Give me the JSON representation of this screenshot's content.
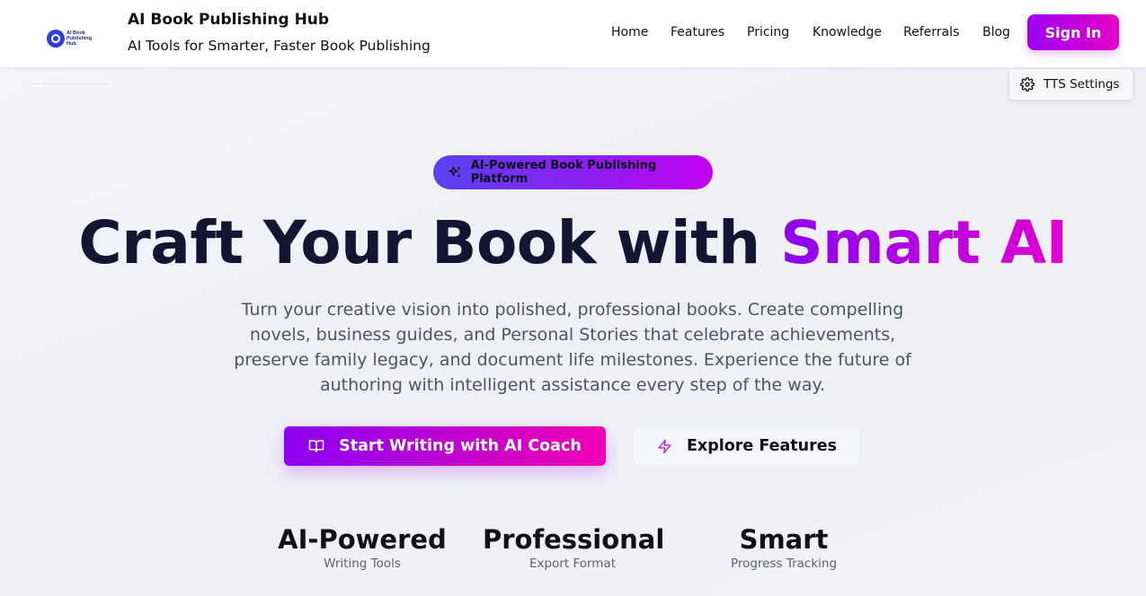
{
  "header": {
    "logo_text": "AI Book Publishing Hub",
    "title": "AI Book Publishing Hub",
    "subtitle": "AI Tools for Smarter, Faster Book Publishing",
    "nav": [
      {
        "label": "Home"
      },
      {
        "label": "Features"
      },
      {
        "label": "Pricing"
      },
      {
        "label": "Knowledge"
      },
      {
        "label": "Referrals"
      },
      {
        "label": "Blog"
      }
    ],
    "signin_label": "Sign In"
  },
  "tts": {
    "label": "TTS Settings",
    "icon": "gear-icon"
  },
  "hero": {
    "badge": {
      "label": "AI-Powered Book Publishing Platform",
      "icon": "sparkles-icon"
    },
    "headline_main": "Craft Your Book with ",
    "headline_accent": "Smart AI",
    "lead": "Turn your creative vision into polished, professional books. Create compelling novels, business guides, and Personal Stories that celebrate achievements, preserve family legacy, and document life milestones. Experience the future of authoring with intelligent assistance every step of the way.",
    "cta_primary": {
      "label": "Start Writing with AI Coach",
      "icon": "book-open-icon"
    },
    "cta_secondary": {
      "label": "Explore Features",
      "icon": "lightning-icon"
    }
  },
  "stats": [
    {
      "title": "AI-Powered",
      "sub": "Writing Tools"
    },
    {
      "title": "Professional",
      "sub": "Export Format"
    },
    {
      "title": "Smart",
      "sub": "Progress Tracking"
    }
  ],
  "colors": {
    "brand_gradient_start": "#8c00f2",
    "brand_gradient_end": "#e000d0",
    "headline": "#151433",
    "badge_start": "#5a43ef"
  }
}
